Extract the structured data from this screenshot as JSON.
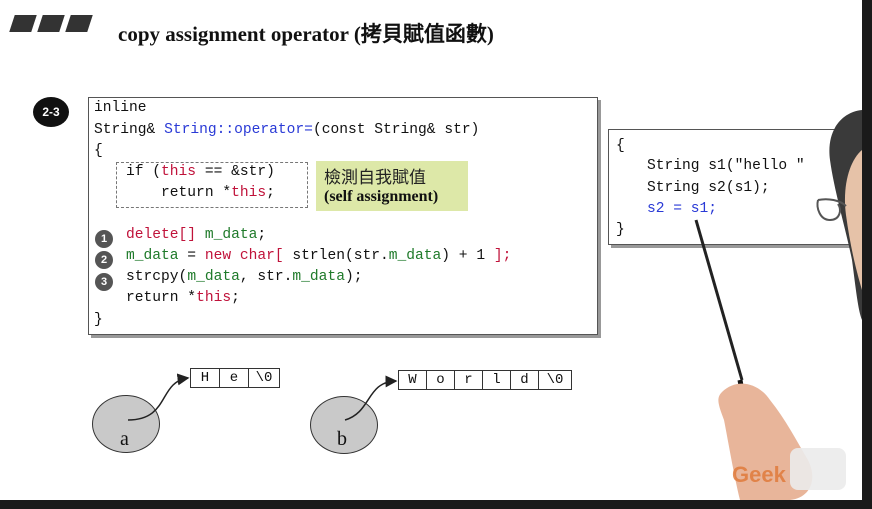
{
  "slide": {
    "title": "copy assignment operator (拷貝賦值函數)",
    "badge": "2-3"
  },
  "code": {
    "l1": "inline",
    "l2_type": "String& ",
    "l2_name": "String::operator=",
    "l2_args": "(const String& str)",
    "l3": "{",
    "if_kw": "if (",
    "if_this": "this",
    "if_rest": " == &str)",
    "ret_a": "    return *",
    "ret_this": "this",
    "ret_end": ";",
    "n1": "1",
    "del_kw": "delete[] ",
    "del_var": "m_data",
    "del_end": ";",
    "n2": "2",
    "new_var": "m_data",
    "new_eq": " = ",
    "new_kw": "new char[",
    "new_mid": " strlen(str.",
    "new_var2": "m_data",
    "new_tail": ") + 1 ",
    "new_close": "];",
    "n3": "3",
    "cpy_fn": "strcpy(",
    "cpy_var": "m_data",
    "cpy_mid": ", str.",
    "cpy_var2": "m_data",
    "cpy_end": ");",
    "ret2_a": "return *",
    "ret2_this": "this",
    "ret2_end": ";",
    "close": "}"
  },
  "note": {
    "zh": "檢測自我賦值",
    "en": "(self assignment)"
  },
  "sample": {
    "open": "{",
    "s1": "String s1(\"hello \"",
    "s2": "String s2(s1);",
    "assign": "s2 = s1;",
    "close": "}"
  },
  "diagram": {
    "a_cells": [
      "H",
      "e",
      "\\0"
    ],
    "b_cells": [
      "W",
      "o",
      "r",
      "l",
      "d",
      "\\0"
    ],
    "a_label": "a",
    "b_label": "b"
  },
  "watermark": {
    "brand": "Geek"
  },
  "colors": {
    "keyword": "#2a3ad6",
    "this": "#c0123a",
    "member": "#1f7a2a",
    "note_bg": "#dde8a8"
  }
}
